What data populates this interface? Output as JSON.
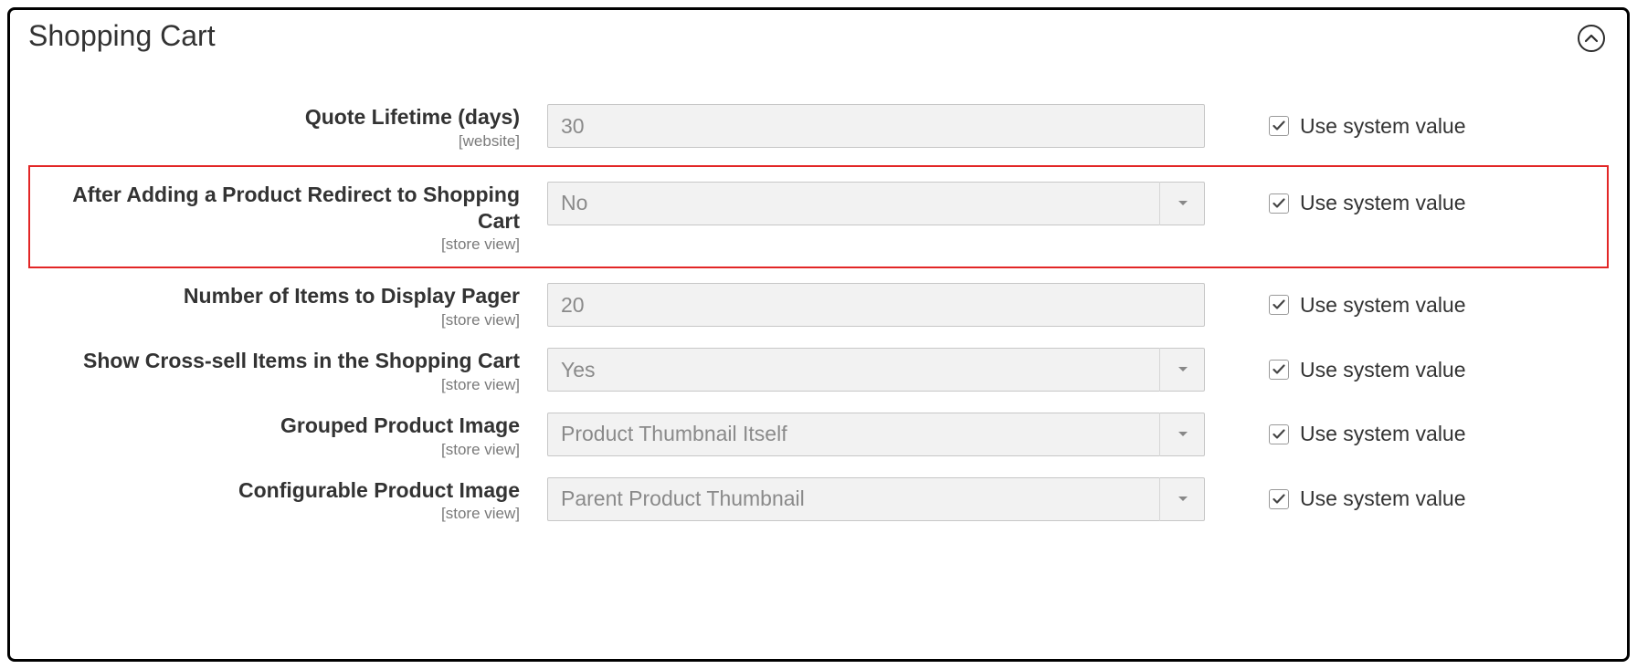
{
  "panel": {
    "title": "Shopping Cart"
  },
  "scopes": {
    "website": "[website]",
    "store_view": "[store view]"
  },
  "common": {
    "use_system_value": "Use system value"
  },
  "fields": {
    "quote_lifetime": {
      "label": "Quote Lifetime (days)",
      "scope_key": "website",
      "value": "30",
      "use_system": true
    },
    "redirect_to_cart": {
      "label": "After Adding a Product Redirect to Shopping Cart",
      "scope_key": "store_view",
      "value": "No",
      "use_system": true
    },
    "pager_items": {
      "label": "Number of Items to Display Pager",
      "scope_key": "store_view",
      "value": "20",
      "use_system": true
    },
    "cross_sell": {
      "label": "Show Cross-sell Items in the Shopping Cart",
      "scope_key": "store_view",
      "value": "Yes",
      "use_system": true
    },
    "grouped_image": {
      "label": "Grouped Product Image",
      "scope_key": "store_view",
      "value": "Product Thumbnail Itself",
      "use_system": true
    },
    "configurable_image": {
      "label": "Configurable Product Image",
      "scope_key": "store_view",
      "value": "Parent Product Thumbnail",
      "use_system": true
    }
  }
}
